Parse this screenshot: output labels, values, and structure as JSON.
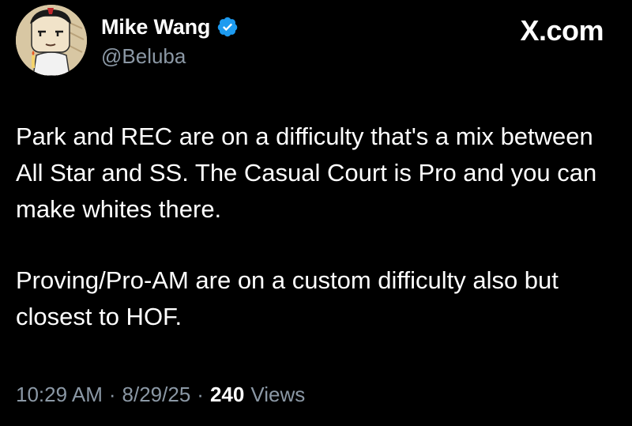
{
  "author": {
    "name": "Mike Wang",
    "handle": "@Beluba",
    "verified": true,
    "avatar_icon": "cartoon-avatar-icon"
  },
  "brand": "X.com",
  "tweet": {
    "paragraphs": [
      "Park and REC are on a difficulty that's a mix between All Star and SS. The Casual Court is Pro and you can make whites there.",
      "Proving/Pro-AM are on a custom difficulty also but closest to HOF."
    ]
  },
  "meta": {
    "time": "10:29 AM",
    "separator": "·",
    "date": "8/29/25",
    "views_count": "240",
    "views_label": "Views"
  },
  "colors": {
    "background": "#000000",
    "text": "#ffffff",
    "secondary": "#8b98a5",
    "verified_badge": "#1d9bf0"
  }
}
